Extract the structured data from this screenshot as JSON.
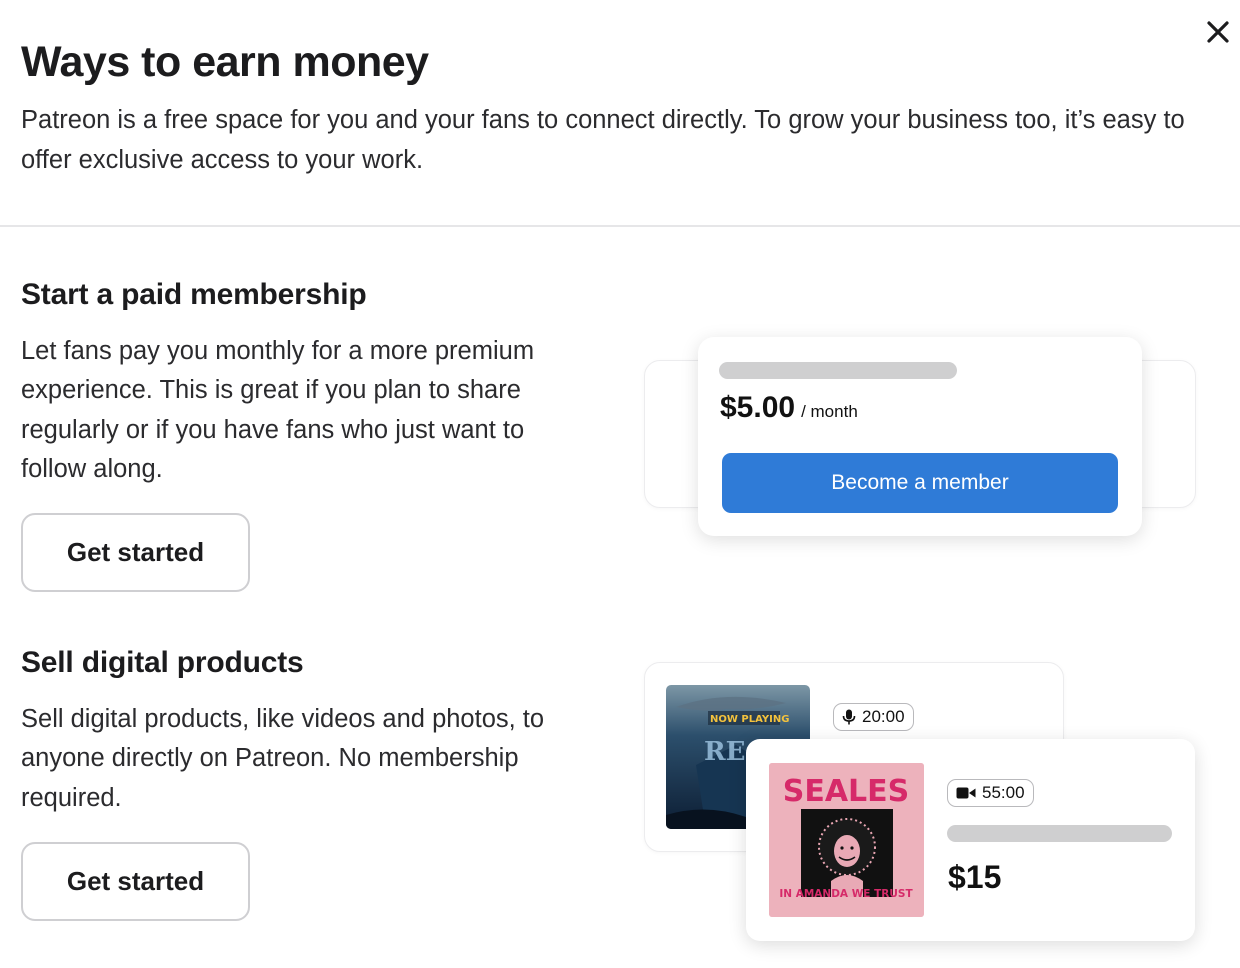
{
  "dialog": {
    "title": "Ways to earn money",
    "intro": "Patreon is a free space for you and your fans to connect directly. To grow your business too, it’s easy to offer exclusive access to your work.",
    "close_icon": "close-icon"
  },
  "membership": {
    "heading": "Start a paid membership",
    "description": "Let fans pay you monthly for a more premium experience. This is great if you plan to share regularly or if you have fans who just want to follow along.",
    "cta_label": "Get started",
    "preview": {
      "price": "$5.00",
      "period": "/ month",
      "button_label": "Become a member",
      "button_color": "#2f7bd7"
    }
  },
  "digital": {
    "heading": "Sell digital products",
    "description": "Sell digital products, like videos and photos, to anyone directly on Patreon. No membership required.",
    "cta_label": "Get started",
    "preview": {
      "audio_duration": "20:00",
      "audio_icon": "microphone-icon",
      "video_duration": "55:00",
      "video_icon": "video-camera-icon",
      "price": "$15",
      "cover1_text": "NOW PLAYING",
      "cover2_title": "SEALES",
      "cover2_subtitle": "IN AMANDA WE TRUST"
    }
  }
}
